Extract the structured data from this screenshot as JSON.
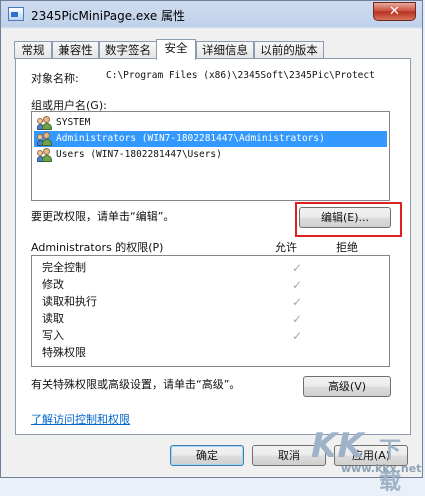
{
  "window": {
    "title": "2345PicMiniPage.exe 属性",
    "close_label": "✕"
  },
  "tabs": [
    {
      "label": "常规"
    },
    {
      "label": "兼容性"
    },
    {
      "label": "数字签名"
    },
    {
      "label": "安全",
      "active": true
    },
    {
      "label": "详细信息"
    },
    {
      "label": "以前的版本"
    }
  ],
  "security": {
    "object_label": "对象名称:",
    "object_value": "C:\\Program Files (x86)\\2345Soft\\2345Pic\\Protect",
    "groups_label": "组或用户名(G):",
    "groups": [
      {
        "name": "SYSTEM",
        "selected": false
      },
      {
        "name": "Administrators (WIN7-1802281447\\Administrators)",
        "selected": true
      },
      {
        "name": "Users (WIN7-1802281447\\Users)",
        "selected": false
      }
    ],
    "change_text": "要更改权限，请单击“编辑”。",
    "edit_button": "编辑(E)...",
    "perm_title": "Administrators 的权限(P)",
    "allow_header": "允许",
    "deny_header": "拒绝",
    "permissions": [
      {
        "name": "完全控制",
        "allow": true
      },
      {
        "name": "修改",
        "allow": true
      },
      {
        "name": "读取和执行",
        "allow": true
      },
      {
        "name": "读取",
        "allow": true
      },
      {
        "name": "写入",
        "allow": true
      },
      {
        "name": "特殊权限",
        "allow": false
      }
    ],
    "check_glyph": "✓",
    "special_text": "有关特殊权限或高级设置，请单击“高级”。",
    "advanced_button": "高级(V)",
    "link_text": "了解访问控制和权限"
  },
  "footer": {
    "ok": "确定",
    "cancel": "取消",
    "apply": "应用(A)"
  },
  "watermark": {
    "logo": "KK",
    "logo_zh": "下载",
    "url": "www.kkx.net"
  },
  "colors": {
    "selection": "#3399ff",
    "highlight": "#dd2222",
    "link": "#0066cc"
  }
}
